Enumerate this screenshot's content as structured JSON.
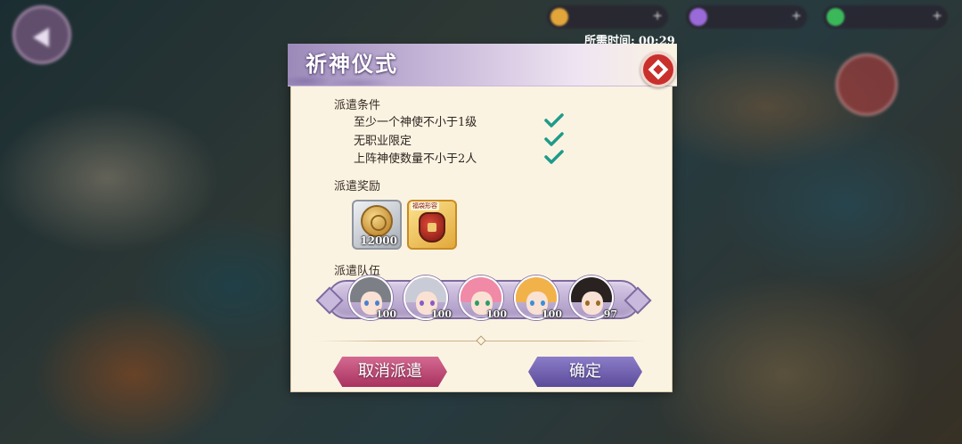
{
  "timer": {
    "label": "所需时间:",
    "value": "00:29"
  },
  "dialog": {
    "title": "祈神仪式",
    "conditions_label": "派遣条件",
    "conditions": [
      {
        "text": "至少一个神使不小于1级",
        "met": true
      },
      {
        "text": "无职业限定",
        "met": true
      },
      {
        "text": "上阵神使数量不小于2人",
        "met": true
      }
    ],
    "rewards_label": "派遣奖励",
    "rewards": [
      {
        "icon": "silver-coin-icon",
        "count": "12000"
      },
      {
        "icon": "red-pouch-icon",
        "tag": "福袋形容"
      }
    ],
    "team_label": "派遣队伍",
    "team": [
      {
        "level": "100",
        "hair": "#7d7f86",
        "eye": "#4a7fd0"
      },
      {
        "level": "100",
        "hair": "#c9cbd6",
        "eye": "#8a5ac7"
      },
      {
        "level": "100",
        "hair": "#f08aa6",
        "eye": "#2f9a6a"
      },
      {
        "level": "100",
        "hair": "#f2b24a",
        "eye": "#3a8fd8"
      },
      {
        "level": "97",
        "hair": "#2a2220",
        "eye": "#9c6a2a"
      }
    ],
    "cancel_label": "取消派遣",
    "confirm_label": "确定"
  },
  "colors": {
    "check": "#1e9b8a",
    "panel_bg": "#fbf3e2",
    "close": "#c9302c"
  }
}
